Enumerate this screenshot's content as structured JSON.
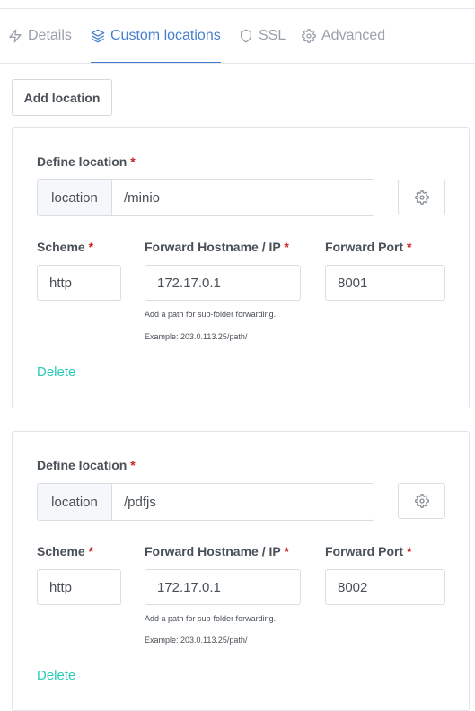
{
  "tabs": [
    {
      "label": "Details",
      "icon": "lightning-icon"
    },
    {
      "label": "Custom locations",
      "icon": "layers-icon"
    },
    {
      "label": "SSL",
      "icon": "shield-icon"
    },
    {
      "label": "Advanced",
      "icon": "gear-icon"
    }
  ],
  "active_tab": "Custom locations",
  "add_location_label": "Add location",
  "labels": {
    "define_location": "Define location",
    "scheme": "Scheme",
    "forward_hostname": "Forward Hostname / IP",
    "forward_port": "Forward Port",
    "required_mark": "*"
  },
  "locations": [
    {
      "prefix": "location",
      "path": "/minio",
      "scheme": "http",
      "hostname": "172.17.0.1",
      "port": "8001",
      "hint": "Add a path for sub-folder forwarding.",
      "example": "Example: 203.0.113.25/path/",
      "delete_label": "Delete"
    },
    {
      "prefix": "location",
      "path": "/pdfjs",
      "scheme": "http",
      "hostname": "172.17.0.1",
      "port": "8002",
      "hint": "Add a path for sub-folder forwarding.",
      "example": "Example: 203.0.113.25/path/",
      "delete_label": "Delete"
    }
  ],
  "colors": {
    "accent": "#467fcf",
    "delete": "#2bcbba",
    "required": "#cd201f"
  }
}
